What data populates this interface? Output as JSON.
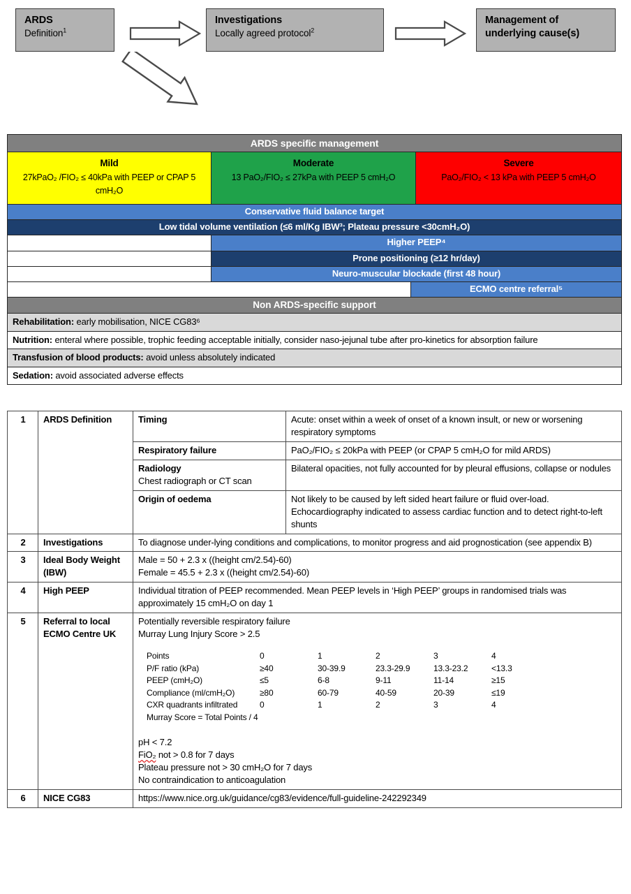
{
  "flow": {
    "boxes": [
      {
        "title": "ARDS",
        "sub": "Definition",
        "sup": "1"
      },
      {
        "title": "Investigations",
        "sub": "Locally agreed protocol",
        "sup": "2"
      },
      {
        "title": "Management of",
        "sub": "underlying cause(s)",
        "sup": ""
      }
    ]
  },
  "management": {
    "header": "ARDS specific management",
    "severity": [
      {
        "name": "Mild",
        "criteria": "27kPaO₂ /FIO₂ ≤ 40kPa with PEEP or CPAP 5 cmH₂O",
        "color": "#ffff00"
      },
      {
        "name": "Moderate",
        "criteria": "13 PaO₂/FIO₂ ≤ 27kPa with PEEP 5 cmH₂O",
        "color": "#1fa24a"
      },
      {
        "name": "Severe",
        "criteria": "PaO₂/FIO₂ < 13 kPa with PEEP 5 cmH₂O",
        "color": "#fe0000"
      }
    ],
    "therapies": [
      {
        "label": "Conservative fluid balance target",
        "span": "all",
        "shade": "light"
      },
      {
        "label": "Low tidal volume ventilation (≤6 ml/Kg IBW³; Plateau pressure <30cmH₂O)",
        "span": "all",
        "shade": "dark"
      },
      {
        "label": "Higher PEEP⁴",
        "span": "right",
        "shade": "light"
      },
      {
        "label": "Prone positioning (≥12 hr/day)",
        "span": "right",
        "shade": "dark"
      },
      {
        "label": "Neuro-muscular blockade (first 48 hour)",
        "span": "right",
        "shade": "light"
      },
      {
        "label": "ECMO centre referral⁵",
        "span": "severe",
        "shade": "light"
      }
    ],
    "support_header": "Non ARDS-specific support",
    "support": [
      {
        "bold": "Rehabilitation:",
        "text": " early mobilisation, NICE CG83⁶",
        "shaded": true
      },
      {
        "bold": "Nutrition:",
        "text": " enteral where possible, trophic feeding acceptable initially, consider naso-jejunal tube after pro-kinetics for absorption failure",
        "shaded": false
      },
      {
        "bold": "Transfusion of blood products:",
        "text": " avoid unless absolutely indicated",
        "shaded": true
      },
      {
        "bold": "Sedation:",
        "text": " avoid associated adverse effects",
        "shaded": false
      }
    ]
  },
  "reference": {
    "row1": {
      "num": "1",
      "label": "ARDS Definition",
      "items": [
        {
          "sub": "Timing",
          "subline2": "",
          "text": "Acute: onset within a week of onset of a known insult, or new or worsening respiratory symptoms"
        },
        {
          "sub": "Respiratory failure",
          "subline2": "",
          "text": "PaO₂/FIO₂ ≤ 20kPa with PEEP (or CPAP 5 cmH₂O for mild ARDS)"
        },
        {
          "sub": "Radiology",
          "subline2": "Chest radiograph or CT scan",
          "text": "Bilateral opacities, not fully accounted for by pleural effusions, collapse or nodules"
        },
        {
          "sub": "Origin of oedema",
          "subline2": "",
          "text": "Not likely to be caused by left sided heart failure or fluid over-load. Echocardiography indicated to assess cardiac function and to detect right-to-left shunts"
        }
      ]
    },
    "row2": {
      "num": "2",
      "label": "Investigations",
      "text": "To diagnose under-lying conditions and complications, to monitor progress and aid prognostication (see appendix B)"
    },
    "row3": {
      "num": "3",
      "label": "Ideal Body Weight (IBW)",
      "line1": "Male = 50 + 2.3 x ((height cm/2.54)-60)",
      "line2": "Female = 45.5 + 2.3 x ((height cm/2.54)-60)"
    },
    "row4": {
      "num": "4",
      "label": "High PEEP",
      "text": "Individual titration of PEEP recommended. Mean PEEP levels in ‘High PEEP’ groups in randomised trials was approximately 15 cmH₂O on day 1"
    },
    "row5": {
      "num": "5",
      "label": "Referral  to local ECMO Centre UK",
      "line1": "Potentially reversible respiratory failure",
      "line2": "Murray Lung Injury Score > 2.5",
      "murray": {
        "header": [
          "Points",
          "0",
          "1",
          "2",
          "3",
          "4"
        ],
        "rows": [
          [
            "P/F ratio (kPa)",
            "≥40",
            "30-39.9",
            "23.3-29.9",
            "13.3-23.2",
            "<13.3"
          ],
          [
            "PEEP (cmH₂O)",
            "≤5",
            "6-8",
            "9-11",
            "11-14",
            "≥15"
          ],
          [
            "Compliance (ml/cmH₂O)",
            "≥80",
            "60-79",
            "40-59",
            "20-39",
            "≤19"
          ],
          [
            "CXR quadrants infiltrated",
            "0",
            "1",
            "2",
            "3",
            "4"
          ]
        ],
        "formula": "Murray Score = Total Points / 4"
      },
      "criteria": [
        {
          "text": "pH < 7.2",
          "misspelled": ""
        },
        {
          "text": " not > 0.8 for 7 days",
          "misspelled": "FiO₂"
        },
        {
          "text": "Plateau pressure not  > 30 cmH₂O for 7 days",
          "misspelled": ""
        },
        {
          "text": "No contraindication to anticoagulation",
          "misspelled": ""
        }
      ]
    },
    "row6": {
      "num": "6",
      "label": "NICE CG83",
      "url": "https://www.nice.org.uk/guidance/cg83/evidence/full-guideline-242292349"
    }
  }
}
